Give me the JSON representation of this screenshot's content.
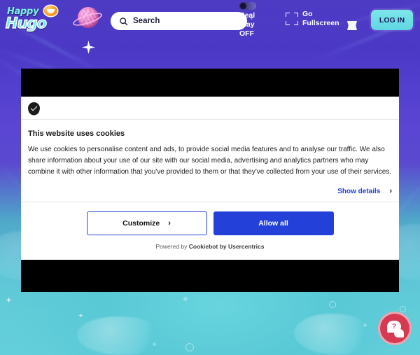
{
  "header": {
    "logo": {
      "line1": "Happy",
      "line2": "Hugo",
      "smiley_icon": "smiley-face-icon"
    },
    "planet_icon": "brain-planet-icon",
    "search": {
      "placeholder": "Search",
      "value": "Search",
      "icon": "search-icon"
    },
    "real_play": {
      "line1": "Real",
      "line2": "Play",
      "line3": "OFF",
      "toggle_state": "off"
    },
    "fullscreen": {
      "line1": "Go",
      "line2": "Fullscreen",
      "icon": "fullscreen-icon"
    },
    "flag_icon": "flag-icon",
    "login_label": "LOG IN"
  },
  "cookie_dialog": {
    "icon": "cookie-icon",
    "title": "This website uses cookies",
    "body": "We use cookies to personalise content and ads, to provide social media features and to analyse our traffic. We also share information about your use of our site with our social media, advertising and analytics partners who may combine it with other information that you've provided to them or that they've collected from your use of their services.",
    "show_details_label": "Show details",
    "show_details_chevron": "›",
    "customize_label": "Customize",
    "customize_chevron": "›",
    "allow_all_label": "Allow all",
    "footer_prefix": "Powered by ",
    "footer_brand": "Cookiebot by Usercentrics"
  },
  "chat": {
    "icon": "chat-help-icon",
    "badge": "?"
  },
  "colors": {
    "brand_cyan": "#6ae8ef",
    "cookie_blue": "#2340d8",
    "chat_red": "#d63a52",
    "header_purple": "#5440cf",
    "bottom_teal": "#62cdd9"
  }
}
